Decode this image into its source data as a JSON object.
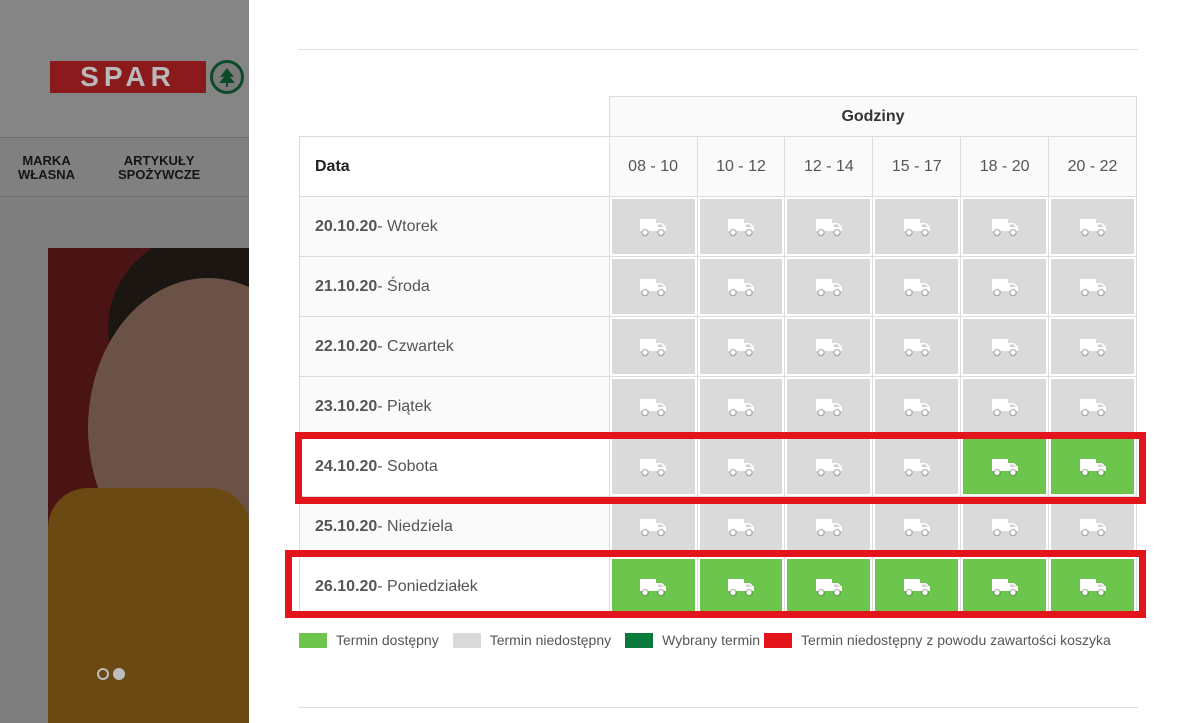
{
  "background": {
    "logo_text": "SPAR",
    "nav": [
      {
        "label": "MARKA\nWŁASNA"
      },
      {
        "label": "ARTYKUŁY\nSPOŻYWCZE"
      }
    ]
  },
  "table": {
    "group_header": "Godziny",
    "date_header": "Data",
    "time_slots": [
      "08 - 10",
      "10 - 12",
      "12 - 14",
      "15 - 17",
      "18 - 20",
      "20 - 22"
    ],
    "rows": [
      {
        "date": "20.10.20",
        "day": " - Wtorek",
        "slots": [
          "unavailable",
          "unavailable",
          "unavailable",
          "unavailable",
          "unavailable",
          "unavailable"
        ],
        "highlighted": false
      },
      {
        "date": "21.10.20",
        "day": " - Środa",
        "slots": [
          "unavailable",
          "unavailable",
          "unavailable",
          "unavailable",
          "unavailable",
          "unavailable"
        ],
        "highlighted": false
      },
      {
        "date": "22.10.20",
        "day": " - Czwartek",
        "slots": [
          "unavailable",
          "unavailable",
          "unavailable",
          "unavailable",
          "unavailable",
          "unavailable"
        ],
        "highlighted": false
      },
      {
        "date": "23.10.20",
        "day": " - Piątek",
        "slots": [
          "unavailable",
          "unavailable",
          "unavailable",
          "unavailable",
          "unavailable",
          "unavailable"
        ],
        "highlighted": false
      },
      {
        "date": "24.10.20",
        "day": " - Sobota",
        "slots": [
          "unavailable",
          "unavailable",
          "unavailable",
          "unavailable",
          "available",
          "available"
        ],
        "highlighted": true
      },
      {
        "date": "25.10.20",
        "day": " - Niedziela",
        "slots": [
          "unavailable",
          "unavailable",
          "unavailable",
          "unavailable",
          "unavailable",
          "unavailable"
        ],
        "highlighted": false
      },
      {
        "date": "26.10.20",
        "day": " - Poniedziałek",
        "slots": [
          "available",
          "available",
          "available",
          "available",
          "available",
          "available"
        ],
        "highlighted": true
      }
    ]
  },
  "legend": [
    {
      "label": "Termin dostępny",
      "color": "#6dc54e"
    },
    {
      "label": "Termin niedostępny",
      "color": "#dadada"
    },
    {
      "label": "Wybrany termin",
      "color": "#0a7a3c"
    },
    {
      "label": "Termin niedostępny z powodu zawartości koszyka",
      "color": "#e3141b"
    }
  ],
  "colors": {
    "available": "#6dc54e",
    "unavailable": "#dadada",
    "highlight": "#e3141b"
  },
  "icons": {
    "slot": "delivery-truck-icon"
  }
}
